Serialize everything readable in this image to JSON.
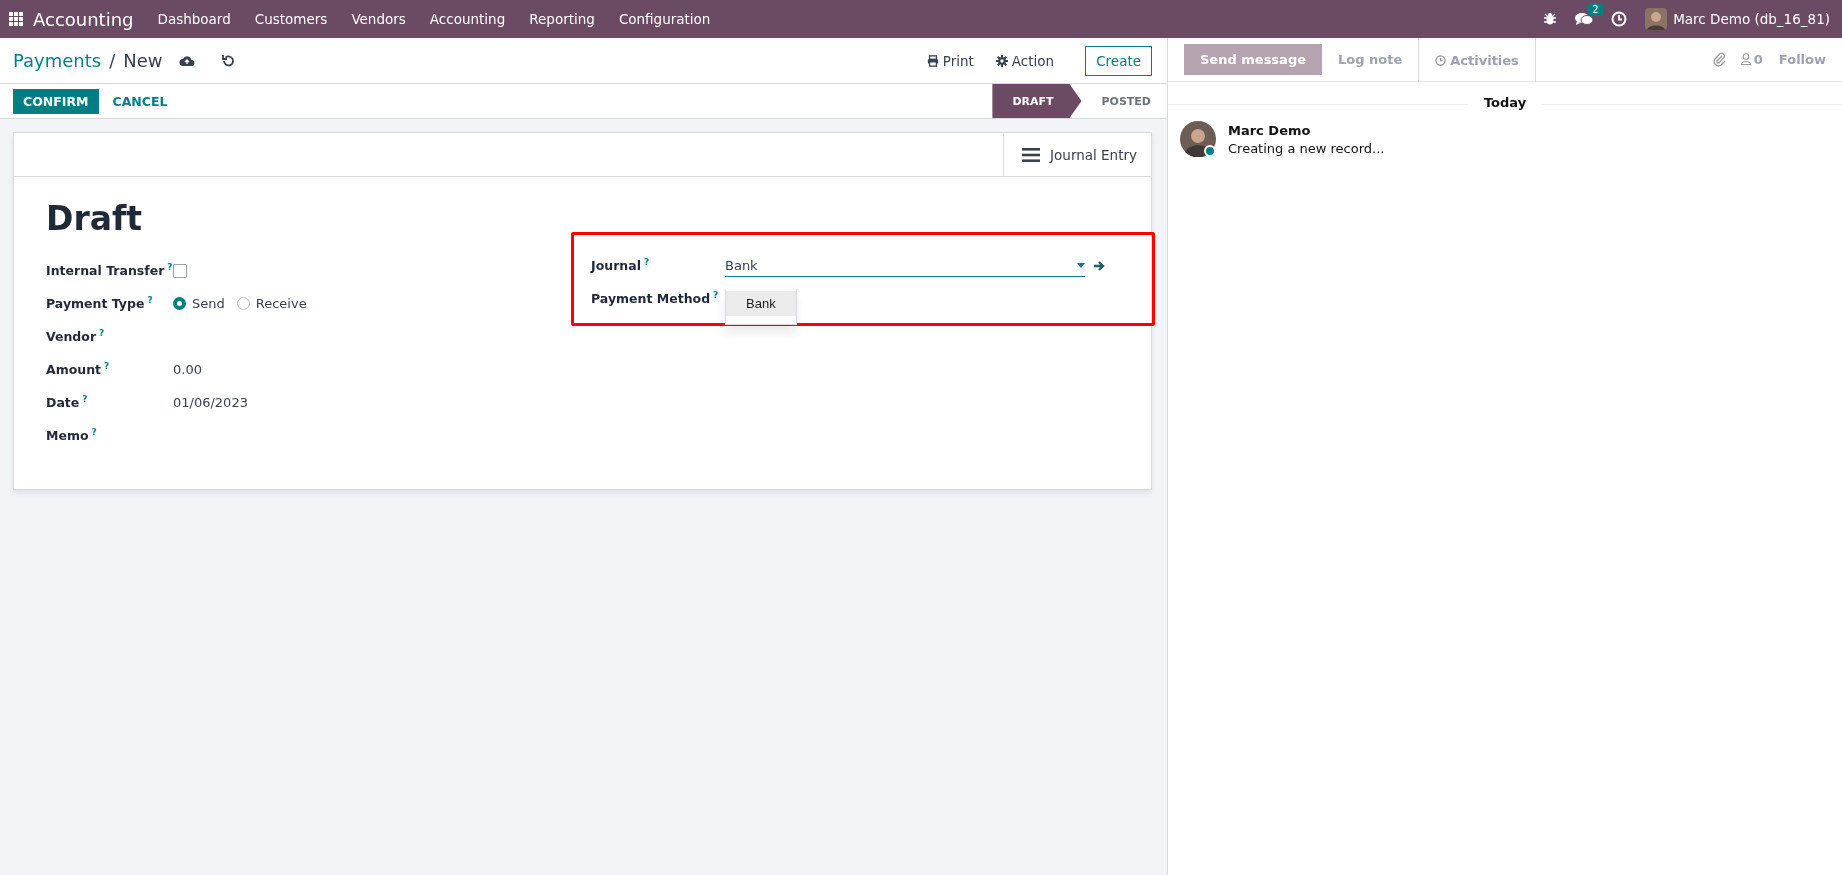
{
  "navbar": {
    "app": "Accounting",
    "menu": [
      "Dashboard",
      "Customers",
      "Vendors",
      "Accounting",
      "Reporting",
      "Configuration"
    ],
    "messages_badge": "2",
    "user": "Marc Demo (db_16_81)"
  },
  "breadcrumb": {
    "parent": "Payments",
    "separator": "/",
    "current": "New"
  },
  "header_buttons": [
    "Print",
    "Action",
    "Create"
  ],
  "actions": [
    {
      "label": "CONFIRM",
      "primary": true
    },
    {
      "label": "CANCEL",
      "primary": false
    }
  ],
  "statusbar": [
    {
      "label": "DRAFT",
      "selected": true
    },
    {
      "label": "POSTED",
      "selected": false
    }
  ],
  "smart_button": "Journal Entry",
  "title": "Draft",
  "left_fields": [
    {
      "kind": "checkbox",
      "label": "Internal Transfer",
      "help": "?",
      "checked": false
    },
    {
      "kind": "radio",
      "label": "Payment Type",
      "help": "?",
      "options": [
        {
          "label": "Send",
          "selected": true
        },
        {
          "label": "Receive",
          "selected": false
        }
      ]
    },
    {
      "kind": "text",
      "label": "Vendor",
      "help": "?"
    },
    {
      "kind": "text",
      "label": "Amount",
      "help": "?",
      "value": "0.00"
    },
    {
      "kind": "text",
      "label": "Date",
      "help": "?",
      "value": "01/06/2023"
    },
    {
      "kind": "text",
      "label": "Memo",
      "help": "?"
    }
  ],
  "right_fields": [
    {
      "kind": "select",
      "label": "Journal",
      "help": "?",
      "value": "Bank"
    },
    {
      "kind": "text",
      "label": "Payment Method",
      "help": "?"
    }
  ],
  "dropdown": {
    "options": [
      "Bank"
    ]
  },
  "chatter": {
    "tabs": [
      {
        "label": "Send message",
        "selected": true
      },
      {
        "label": "Log note",
        "selected": false
      },
      {
        "label": "Activities",
        "selected": false
      }
    ],
    "followers": "0",
    "follow": "Follow",
    "date": "Today",
    "messages": [
      {
        "author": "Marc Demo",
        "body": "Creating a new record..."
      }
    ]
  }
}
